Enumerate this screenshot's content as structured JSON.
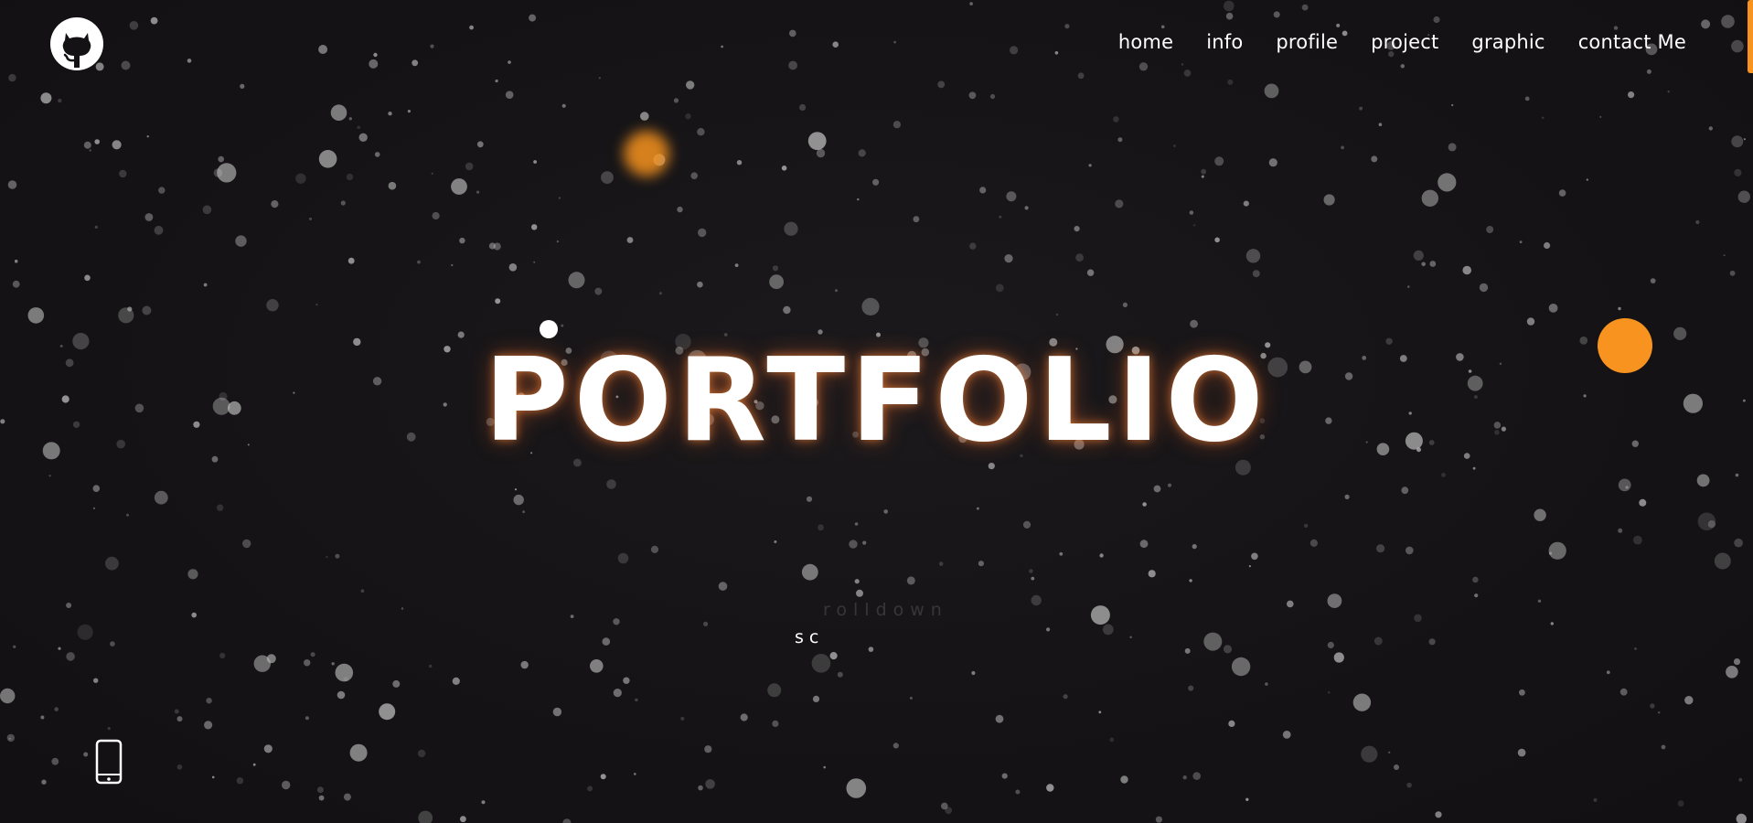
{
  "header": {
    "logo_icon": "github-octocat-icon",
    "nav_items": [
      {
        "label": "home"
      },
      {
        "label": "info"
      },
      {
        "label": "profile"
      },
      {
        "label": "project"
      },
      {
        "label": "graphic"
      },
      {
        "label": "contact Me"
      }
    ]
  },
  "hero": {
    "title": "PORTFOLIO",
    "scroll_hint_faded": "rolldown",
    "scroll_hint_main": "sc"
  },
  "footer": {
    "contact_icon": "mobile-phone-icon"
  },
  "colors": {
    "background": "#141214",
    "accent": "#f7931e",
    "text": "#ffffff",
    "particle": "#bdbdbd"
  }
}
